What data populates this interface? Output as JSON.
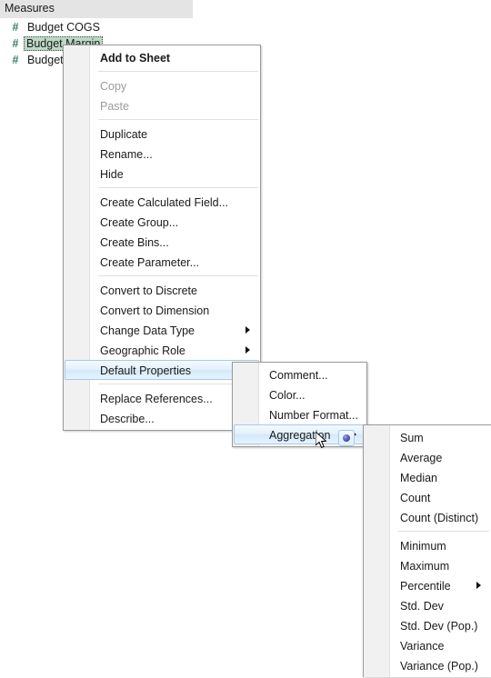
{
  "data_pane": {
    "header": "Measures",
    "fields": [
      {
        "icon": "#",
        "icon_name": "number-field-icon",
        "label": "Budget COGS",
        "selected": false
      },
      {
        "icon": "#",
        "icon_name": "number-field-icon",
        "label": "Budget Margin",
        "selected": true
      },
      {
        "icon": "#",
        "icon_name": "number-field-icon",
        "label": "Budget",
        "selected": false
      }
    ]
  },
  "context_menu": {
    "name": "field-context-menu",
    "groups": [
      {
        "items": [
          {
            "label": "Add to Sheet",
            "bold": true,
            "disabled": false,
            "submenu": false
          }
        ]
      },
      {
        "items": [
          {
            "label": "Copy",
            "bold": false,
            "disabled": true,
            "submenu": false
          },
          {
            "label": "Paste",
            "bold": false,
            "disabled": true,
            "submenu": false
          }
        ]
      },
      {
        "items": [
          {
            "label": "Duplicate",
            "bold": false,
            "disabled": false,
            "submenu": false
          },
          {
            "label": "Rename...",
            "bold": false,
            "disabled": false,
            "submenu": false
          },
          {
            "label": "Hide",
            "bold": false,
            "disabled": false,
            "submenu": false
          }
        ]
      },
      {
        "items": [
          {
            "label": "Create Calculated Field...",
            "bold": false,
            "disabled": false,
            "submenu": false
          },
          {
            "label": "Create Group...",
            "bold": false,
            "disabled": false,
            "submenu": false
          },
          {
            "label": "Create Bins...",
            "bold": false,
            "disabled": false,
            "submenu": false
          },
          {
            "label": "Create Parameter...",
            "bold": false,
            "disabled": false,
            "submenu": false
          }
        ]
      },
      {
        "items": [
          {
            "label": "Convert to Discrete",
            "bold": false,
            "disabled": false,
            "submenu": false
          },
          {
            "label": "Convert to Dimension",
            "bold": false,
            "disabled": false,
            "submenu": false
          },
          {
            "label": "Change Data Type",
            "bold": false,
            "disabled": false,
            "submenu": true
          },
          {
            "label": "Geographic Role",
            "bold": false,
            "disabled": false,
            "submenu": true
          },
          {
            "label": "Default Properties",
            "bold": false,
            "disabled": false,
            "submenu": true,
            "hover": true
          }
        ]
      },
      {
        "items": [
          {
            "label": "Replace References...",
            "bold": false,
            "disabled": false,
            "submenu": false
          },
          {
            "label": "Describe...",
            "bold": false,
            "disabled": false,
            "submenu": false
          }
        ]
      }
    ]
  },
  "default_properties_menu": {
    "name": "default-properties-submenu",
    "items": [
      {
        "label": "Comment...",
        "submenu": false
      },
      {
        "label": "Color...",
        "submenu": false
      },
      {
        "label": "Number Format...",
        "submenu": false
      },
      {
        "label": "Aggregation",
        "submenu": true,
        "hover": true
      }
    ]
  },
  "aggregation_menu": {
    "name": "aggregation-submenu",
    "groups": [
      {
        "items": [
          {
            "label": "Sum",
            "selected": true,
            "submenu": false
          },
          {
            "label": "Average",
            "selected": false,
            "submenu": false
          },
          {
            "label": "Median",
            "selected": false,
            "submenu": false
          },
          {
            "label": "Count",
            "selected": false,
            "submenu": false
          },
          {
            "label": "Count (Distinct)",
            "selected": false,
            "submenu": false
          }
        ]
      },
      {
        "items": [
          {
            "label": "Minimum",
            "selected": false,
            "submenu": false
          },
          {
            "label": "Maximum",
            "selected": false,
            "submenu": false
          },
          {
            "label": "Percentile",
            "selected": false,
            "submenu": true
          },
          {
            "label": "Std. Dev",
            "selected": false,
            "submenu": false
          },
          {
            "label": "Std. Dev (Pop.)",
            "selected": false,
            "submenu": false
          },
          {
            "label": "Variance",
            "selected": false,
            "submenu": false
          },
          {
            "label": "Variance (Pop.)",
            "selected": false,
            "submenu": false
          }
        ]
      }
    ]
  },
  "colors": {
    "menu_background": "#ffffff",
    "gutter": "#f1f1f1",
    "menu_border": "#9a9a9a",
    "hover_border": "#a7c9e8",
    "hover_fill": "#d3e8fa",
    "field_selection": "#bcd8c6",
    "field_icon": "#2f7d62",
    "header_background": "#e4e4e4",
    "disabled_text": "#9b9b9b"
  }
}
